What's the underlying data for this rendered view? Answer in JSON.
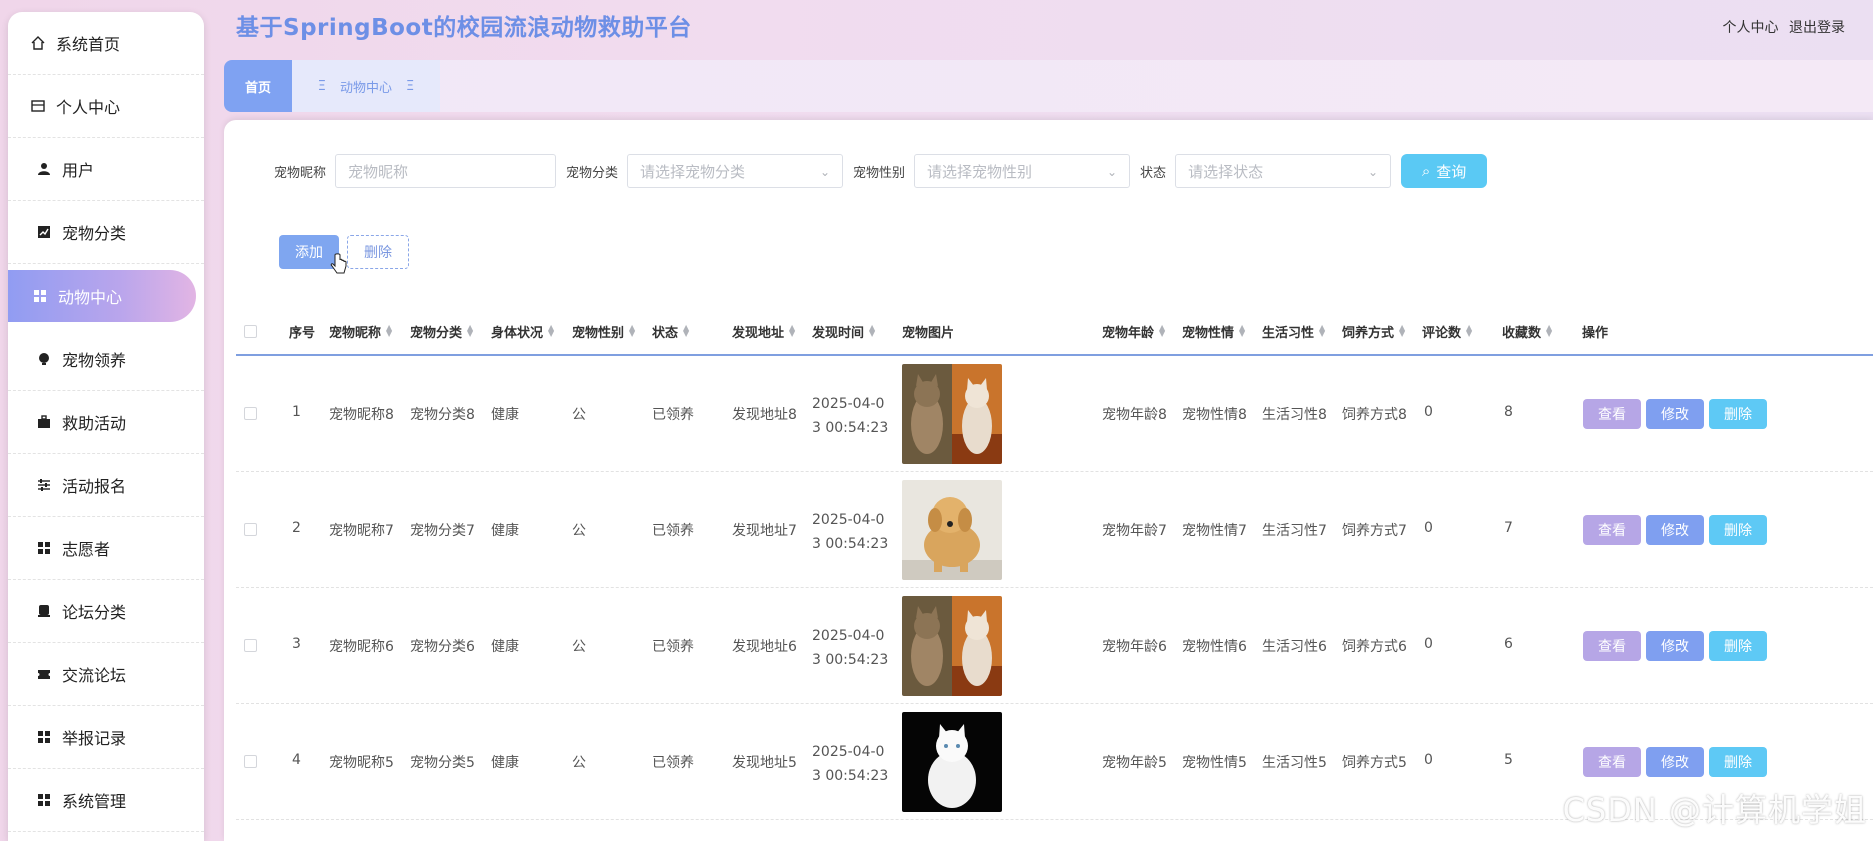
{
  "app": {
    "title": "基于SpringBoot的校园流浪动物救助平台",
    "profile": "个人中心",
    "logout": "退出登录"
  },
  "sidebar": {
    "items": [
      {
        "label": "系统首页",
        "icon": "home-icon"
      },
      {
        "label": "个人中心",
        "icon": "card-icon"
      },
      {
        "label": "用户",
        "icon": "user-icon"
      },
      {
        "label": "宠物分类",
        "icon": "chart-icon"
      },
      {
        "label": "动物中心",
        "icon": "grid-icon",
        "active": true
      },
      {
        "label": "宠物领养",
        "icon": "bulb-icon"
      },
      {
        "label": "救助活动",
        "icon": "briefcase-icon"
      },
      {
        "label": "活动报名",
        "icon": "sliders-icon"
      },
      {
        "label": "志愿者",
        "icon": "grid-icon"
      },
      {
        "label": "论坛分类",
        "icon": "box-icon"
      },
      {
        "label": "交流论坛",
        "icon": "ticket-icon"
      },
      {
        "label": "举报记录",
        "icon": "grid-icon"
      },
      {
        "label": "系统管理",
        "icon": "grid-icon"
      }
    ]
  },
  "tabs": {
    "home": "首页",
    "animal": "动物中心",
    "close_glyph": "Ξ"
  },
  "filters": {
    "nickname_label": "宠物昵称",
    "nickname_placeholder": "宠物昵称",
    "category_label": "宠物分类",
    "category_placeholder": "请选择宠物分类",
    "gender_label": "宠物性别",
    "gender_placeholder": "请选择宠物性别",
    "status_label": "状态",
    "status_placeholder": "请选择状态",
    "search": "查询"
  },
  "actions": {
    "add": "添加",
    "delete": "删除"
  },
  "table": {
    "headers": [
      "序号",
      "宠物昵称",
      "宠物分类",
      "身体状况",
      "宠物性别",
      "状态",
      "发现地址",
      "发现时间",
      "宠物图片",
      "宠物年龄",
      "宠物性情",
      "生活习性",
      "饲养方式",
      "评论数",
      "收藏数",
      "操作"
    ],
    "rows": [
      {
        "index": "1",
        "nickname": "宠物昵称8",
        "category": "宠物分类8",
        "health": "健康",
        "gender": "公",
        "status": "已领养",
        "address": "发现地址8",
        "time1": "2025-04-0",
        "time2": "3 00:54:23",
        "image": "kittens",
        "age": "宠物年龄8",
        "temper": "宠物性情8",
        "habit": "生活习性8",
        "feeding": "饲养方式8",
        "comments": "0",
        "favorites": "8"
      },
      {
        "index": "2",
        "nickname": "宠物昵称7",
        "category": "宠物分类7",
        "health": "健康",
        "gender": "公",
        "status": "已领养",
        "address": "发现地址7",
        "time1": "2025-04-0",
        "time2": "3 00:54:23",
        "image": "puppy",
        "age": "宠物年龄7",
        "temper": "宠物性情7",
        "habit": "生活习性7",
        "feeding": "饲养方式7",
        "comments": "0",
        "favorites": "7"
      },
      {
        "index": "3",
        "nickname": "宠物昵称6",
        "category": "宠物分类6",
        "health": "健康",
        "gender": "公",
        "status": "已领养",
        "address": "发现地址6",
        "time1": "2025-04-0",
        "time2": "3 00:54:23",
        "image": "kittens",
        "age": "宠物年龄6",
        "temper": "宠物性情6",
        "habit": "生活习性6",
        "feeding": "饲养方式6",
        "comments": "0",
        "favorites": "6"
      },
      {
        "index": "4",
        "nickname": "宠物昵称5",
        "category": "宠物分类5",
        "health": "健康",
        "gender": "公",
        "status": "已领养",
        "address": "发现地址5",
        "time1": "2025-04-0",
        "time2": "3 00:54:23",
        "image": "white-cat",
        "age": "宠物年龄5",
        "temper": "宠物性情5",
        "habit": "生活习性5",
        "feeding": "饲养方式5",
        "comments": "0",
        "favorites": "5"
      }
    ],
    "row_actions": {
      "view": "查看",
      "edit": "修改",
      "delete": "删除"
    }
  },
  "watermark": "CSDN @计算机学姐",
  "colors": {
    "accent": "#7f9ff0",
    "title": "#6d8fe6",
    "search": "#5ac9f4",
    "view": "#b6a6e6"
  }
}
